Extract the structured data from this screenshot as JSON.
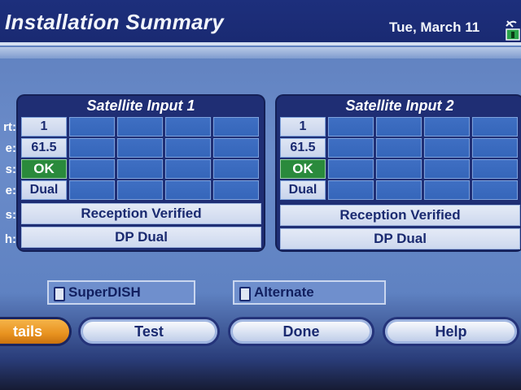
{
  "header": {
    "title": "Installation Summary",
    "date": "Tue, March 11"
  },
  "icons": {
    "status": "satellite-dish-icon"
  },
  "row_labels": [
    "rt:",
    "e:",
    "s:",
    "e:",
    "s:",
    "h:"
  ],
  "panels": [
    {
      "title": "Satellite Input 1",
      "port": "1",
      "orbital": "61.5",
      "status": "OK",
      "type": "Dual",
      "reception": "Reception Verified",
      "switch": "DP Dual"
    },
    {
      "title": "Satellite Input 2",
      "port": "1",
      "orbital": "61.5",
      "status": "OK",
      "type": "Dual",
      "reception": "Reception Verified",
      "switch": "DP Dual"
    }
  ],
  "options": {
    "superdish": "SuperDISH",
    "alternate": "Alternate"
  },
  "buttons": {
    "details": "tails",
    "test": "Test",
    "done": "Done",
    "help": "Help"
  },
  "colors": {
    "ok_green": "#2a8a3c",
    "active_orange": "#e8921f",
    "panel_navy": "#1f2e74"
  }
}
